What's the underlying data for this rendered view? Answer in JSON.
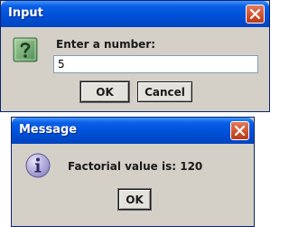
{
  "input_dialog": {
    "title": "Input",
    "icon": "question-icon",
    "prompt": "Enter a number:",
    "value": "5",
    "ok_label": "OK",
    "cancel_label": "Cancel"
  },
  "message_dialog": {
    "title": "Message",
    "icon": "information-icon",
    "message": "Factorial value is: 120",
    "ok_label": "OK"
  },
  "colors": {
    "titlebar": "#0050d8",
    "dialog_bg": "#d4d0c8",
    "close_button": "#d2522e"
  }
}
